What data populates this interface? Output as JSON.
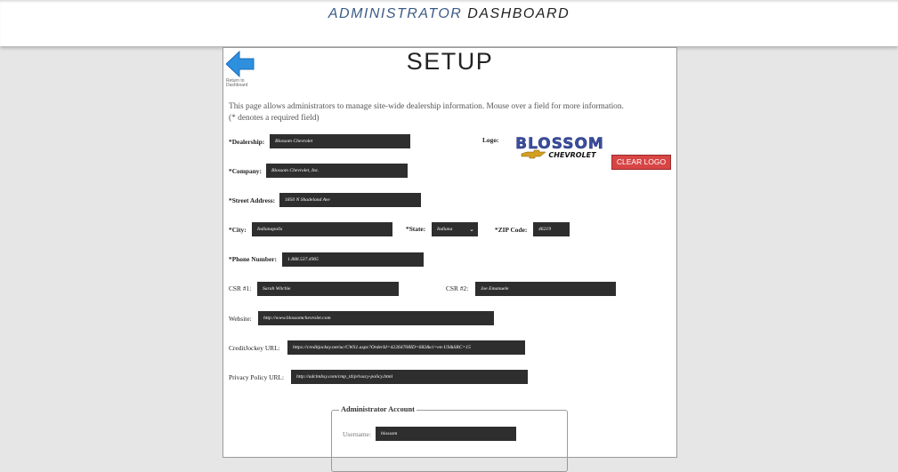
{
  "header": {
    "title_part1": "ADMINISTRATOR",
    "title_part2": "DASHBOARD"
  },
  "page": {
    "back_label": "Return to Dashboard",
    "back_icon": "arrow-left-icon",
    "title": "SETUP",
    "intro_line1": "This page allows administrators to manage site-wide dealership information. Mouse over a field for more information.",
    "intro_line2": "(* denotes a required field)"
  },
  "form": {
    "dealership": {
      "label": "*Dealership:",
      "value": "Blossom Chevrolet"
    },
    "logo_label": "Logo:",
    "logo": {
      "brand": "BLOSSOM",
      "make": "CHEVROLET",
      "brand_color": "#3a4ea0",
      "bowtie_color": "#d4a020"
    },
    "clear_logo_label": "CLEAR LOGO",
    "company": {
      "label": "*Company:",
      "value": "Blossom Chevrolet, Inc."
    },
    "street": {
      "label": "*Street Address:",
      "value": "1850 N Shadeland Ave"
    },
    "city": {
      "label": "*City:",
      "value": "Indianapolis"
    },
    "state": {
      "label": "*State:",
      "value": "Indiana"
    },
    "zip": {
      "label": "*ZIP Code:",
      "value": "46219"
    },
    "phone": {
      "label": "*Phone Number:",
      "value": "1.888.537.4905"
    },
    "csr1": {
      "label": "CSR #1:",
      "value": "Sarah Witchie"
    },
    "csr2": {
      "label": "CSR #2:",
      "value": "Joe Emanuele"
    },
    "website": {
      "label": "Website:",
      "value": "http://www.blossomchevrolet.com"
    },
    "creditjockey": {
      "label": "CreditJockey URL:",
      "value": "https://creditjockey.net/uc/CWS1.aspx?OrderId=42264708ID=682&ci=en-US&SRC=15"
    },
    "privacy": {
      "label": "Privacy Policy URL:",
      "value": "http://adclmbsy.com/cmp_t4/privacy-policy.html"
    }
  },
  "admin": {
    "legend": "Administrator Account",
    "username_label": "Username:",
    "username_value": "blossom"
  },
  "colors": {
    "accent_blue": "#2f8fdf",
    "clear_button": "#d84545",
    "field_bg": "#2e2e2e"
  }
}
